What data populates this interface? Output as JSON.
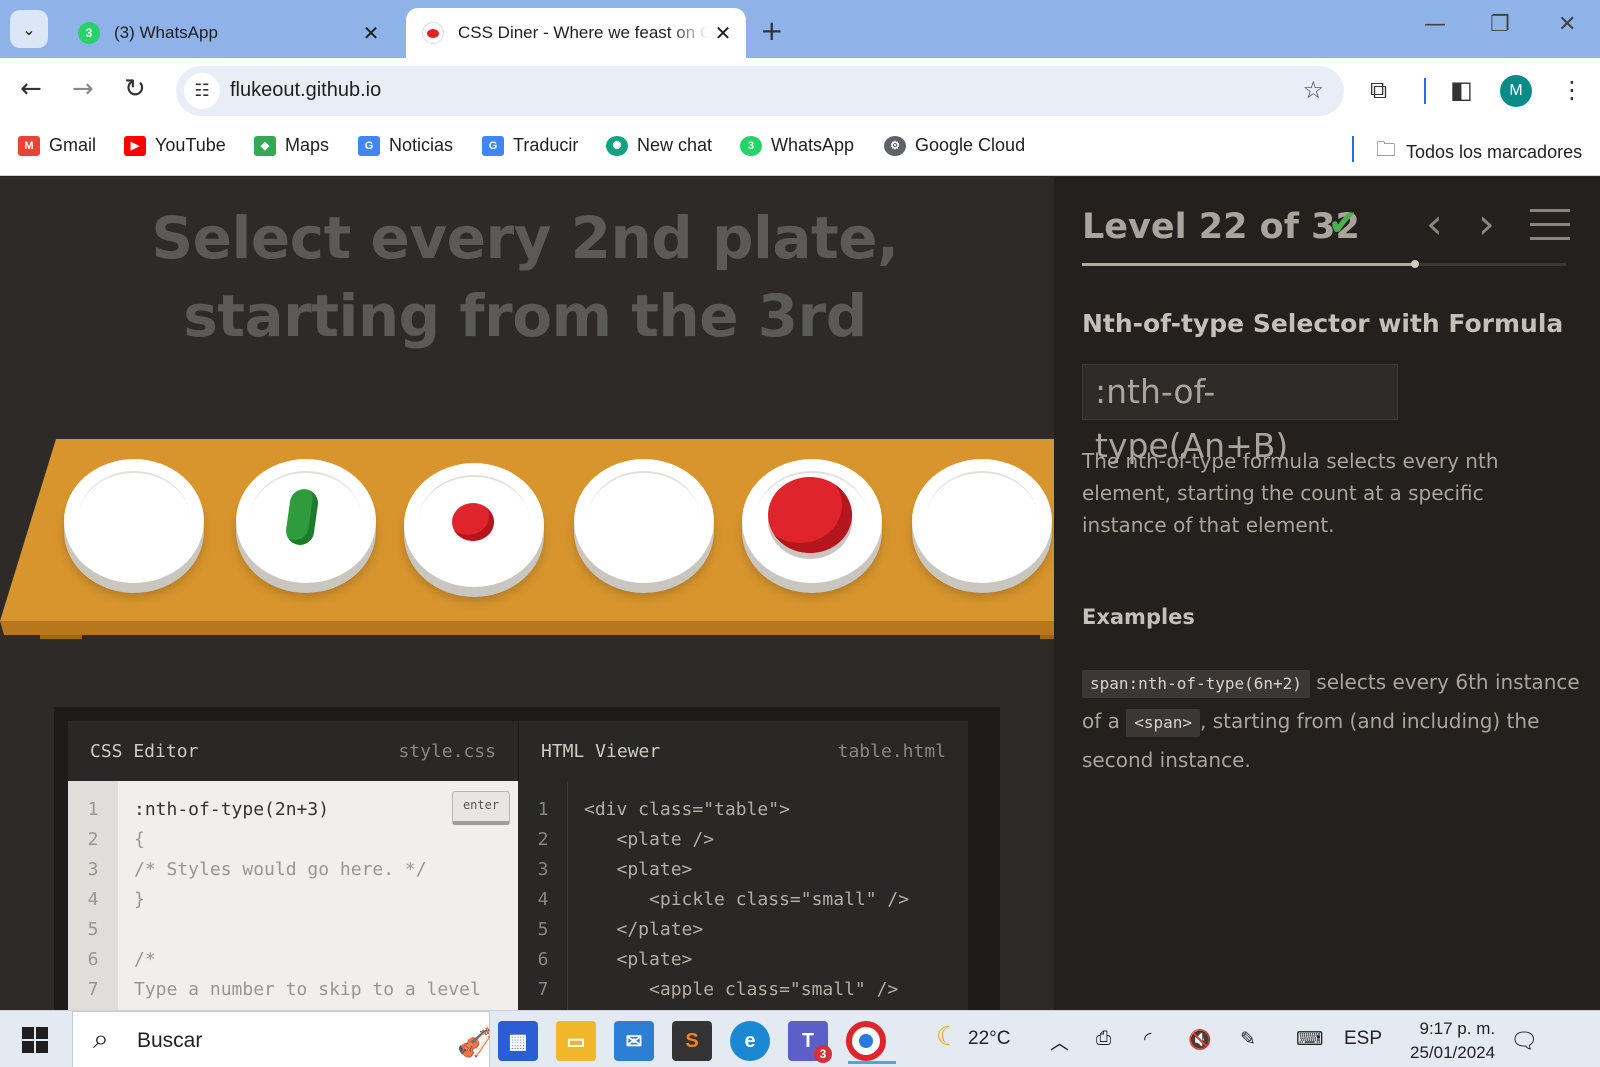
{
  "browser": {
    "tabs": [
      {
        "title": "(3) WhatsApp",
        "badge": "3",
        "active": false
      },
      {
        "title": "CSS Diner - Where we feast on CSS Selectors!",
        "active": true
      }
    ],
    "url": "flukeout.github.io",
    "profile_initial": "M",
    "bookmarks": [
      {
        "label": "Gmail",
        "icon": "gmail-icon",
        "color": "#ea4335"
      },
      {
        "label": "YouTube",
        "icon": "youtube-icon",
        "color": "#ff0000"
      },
      {
        "label": "Maps",
        "icon": "maps-icon",
        "color": "#34a853"
      },
      {
        "label": "Noticias",
        "icon": "news-icon",
        "color": "#4285f4"
      },
      {
        "label": "Traducir",
        "icon": "translate-icon",
        "color": "#4285f4"
      },
      {
        "label": "New chat",
        "icon": "chatgpt-icon",
        "color": "#10a37f"
      },
      {
        "label": "WhatsApp",
        "icon": "whatsapp-icon",
        "color": "#25d366",
        "badge": "3"
      },
      {
        "label": "Google Cloud",
        "icon": "cloud-icon",
        "color": "#5f6368"
      }
    ],
    "all_bookmarks": "Todos los marcadores"
  },
  "game": {
    "instruction": "Select every 2nd plate, starting from the 3rd",
    "plates": [
      {
        "item": "none"
      },
      {
        "item": "pickle"
      },
      {
        "item": "small-apple"
      },
      {
        "item": "none"
      },
      {
        "item": "apple"
      },
      {
        "item": "none"
      }
    ],
    "css_editor": {
      "title": "CSS Editor",
      "file": "style.css",
      "enter_label": "enter",
      "lines": [
        {
          "n": "1",
          "text": ":nth-of-type(2n+3)"
        },
        {
          "n": "2",
          "text": "{"
        },
        {
          "n": "3",
          "text": "/* Styles would go here. */"
        },
        {
          "n": "4",
          "text": "}"
        },
        {
          "n": "5",
          "text": ""
        },
        {
          "n": "6",
          "text": "/*"
        },
        {
          "n": "7",
          "text": "Type a number to skip to a level"
        }
      ]
    },
    "html_viewer": {
      "title": "HTML Viewer",
      "file": "table.html",
      "lines": [
        {
          "n": "1",
          "text": "<div class=\"table\">"
        },
        {
          "n": "2",
          "text": "   <plate />"
        },
        {
          "n": "3",
          "text": "   <plate>"
        },
        {
          "n": "4",
          "text": "      <pickle class=\"small\" />"
        },
        {
          "n": "5",
          "text": "   </plate>"
        },
        {
          "n": "6",
          "text": "   <plate>"
        },
        {
          "n": "7",
          "text": "      <apple class=\"small\" />"
        }
      ]
    }
  },
  "sidebar": {
    "level_text": "Level 22 of 32",
    "level_current": 22,
    "level_total": 32,
    "completed": true,
    "selector_name": "Nth-of-type Selector with Formula",
    "syntax": ":nth-of-type(An+B)",
    "hint": "The nth-of-type formula selects every nth element, starting the count at a specific instance of that element.",
    "examples_title": "Examples",
    "example": {
      "code": "span:nth-of-type(6n+2)",
      "text1": " selects every 6th instance of a ",
      "tag": "<span>",
      "text2": ", starting from (and including) the second instance."
    }
  },
  "taskbar": {
    "search_placeholder": "Buscar",
    "weather": "22°C",
    "language": "ESP",
    "time": "9:17 p. m.",
    "date": "25/01/2024",
    "teams_badge": "3"
  },
  "colors": {
    "table_wood": "#d8952d",
    "table_edge": "#c17f1f",
    "pickle": "#2e9b3c",
    "apple": "#e0242c",
    "accent_check": "#4caf50"
  }
}
